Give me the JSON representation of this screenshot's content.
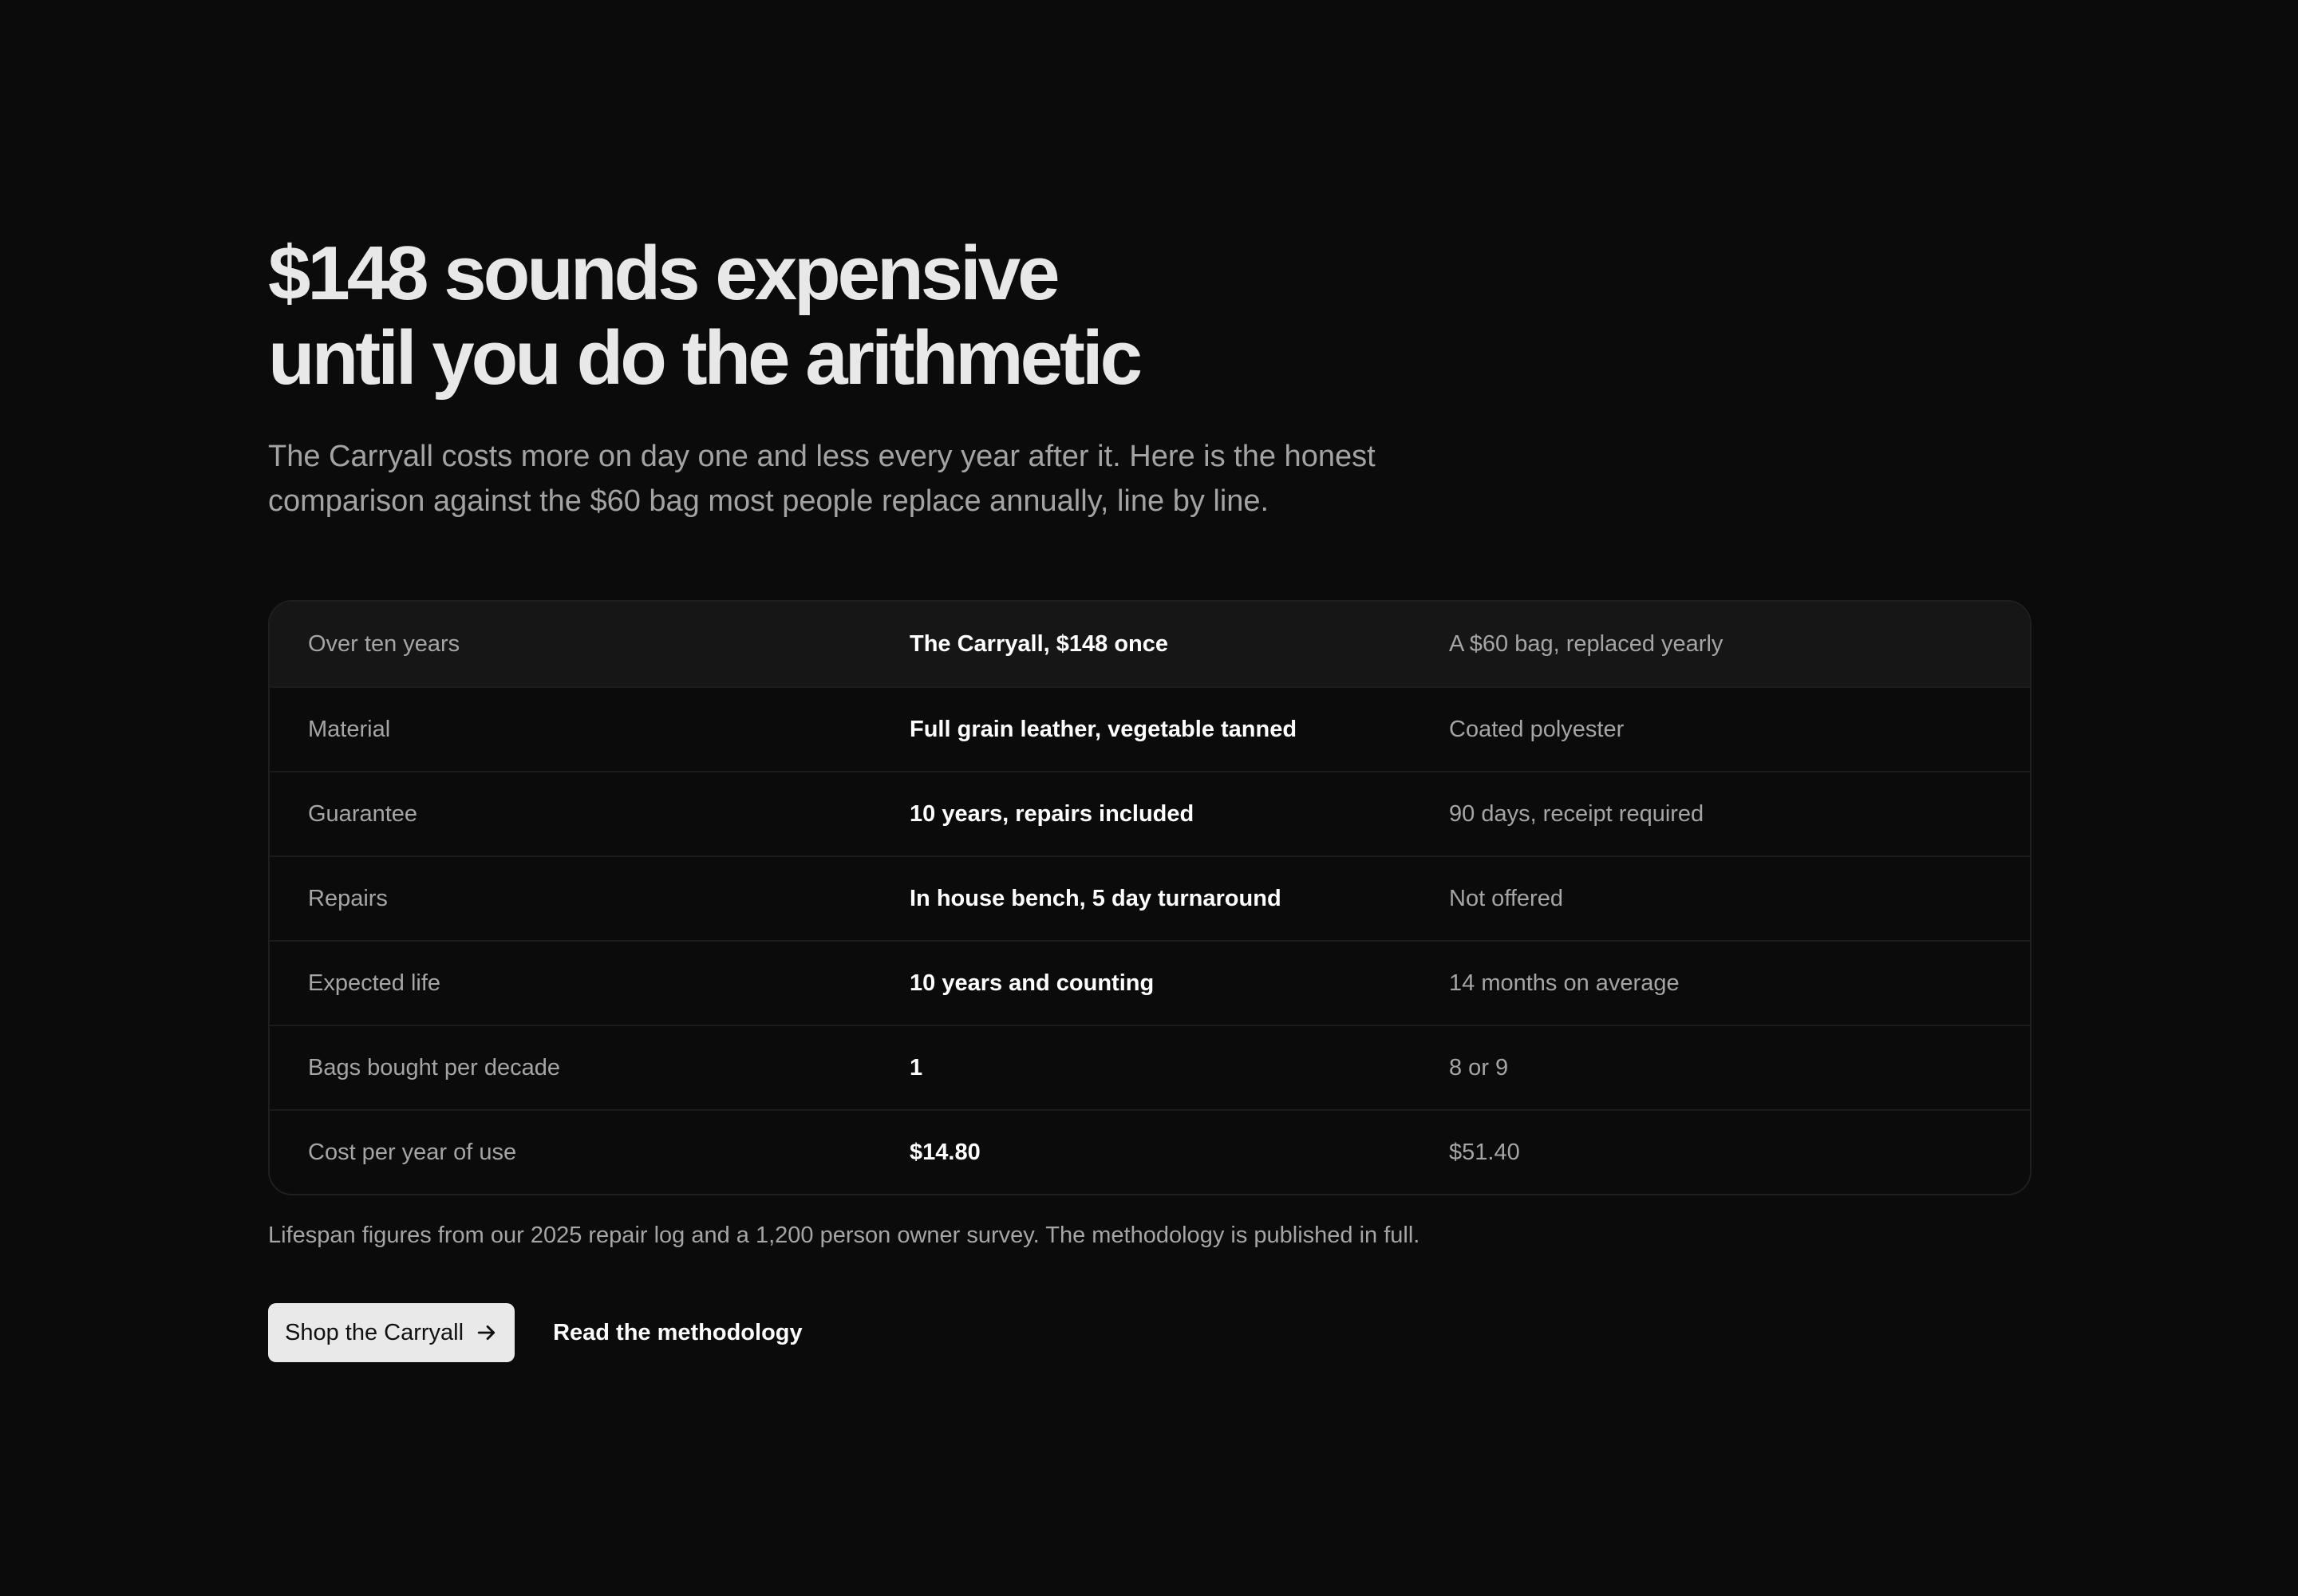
{
  "hero": {
    "title_line1": "$148 sounds expensive",
    "title_line2": "until you do the arithmetic",
    "lede": "The Carryall costs more on day one and less every year after it. Here is the honest comparison against the $60 bag most people replace annually, line by line."
  },
  "comparison": {
    "headers": [
      "Over ten years",
      "The Carryall, $148 once",
      "A $60 bag, replaced yearly"
    ],
    "rows": [
      [
        "Material",
        "Full grain leather, vegetable tanned",
        "Coated polyester"
      ],
      [
        "Guarantee",
        "10 years, repairs included",
        "90 days, receipt required"
      ],
      [
        "Repairs",
        "In house bench, 5 day turnaround",
        "Not offered"
      ],
      [
        "Expected life",
        "10 years and counting",
        "14 months on average"
      ],
      [
        "Bags bought per decade",
        "1",
        "8 or 9"
      ],
      [
        "Cost per year of use",
        "$14.80",
        "$51.40"
      ]
    ]
  },
  "footnote": "Lifespan figures from our 2025 repair log and a 1,200 person owner survey. The methodology is published in full.",
  "actions": {
    "primary_label": "Shop the Carryall",
    "primary_icon": "arrow-right-icon",
    "secondary_label": "Read the methodology"
  },
  "colors": {
    "background": "#0b0b0b",
    "header_row": "#161616",
    "button_bg": "#e9e9e9"
  }
}
